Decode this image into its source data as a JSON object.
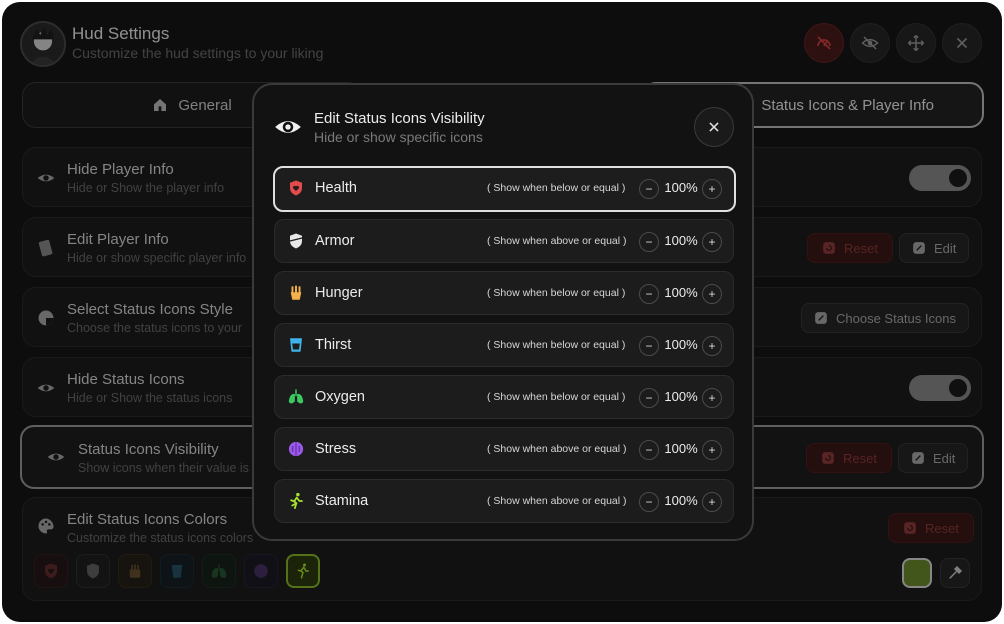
{
  "header": {
    "title": "Hud Settings",
    "subtitle": "Customize the hud settings to your liking",
    "buttons": [
      "speedometer-off-icon",
      "eye-off-icon",
      "move-icon",
      "close-icon"
    ]
  },
  "tabs": [
    {
      "label": "General",
      "icon": "home-icon"
    },
    {
      "label": "Status Icons & Player Info",
      "icon": ""
    }
  ],
  "rows": [
    {
      "title": "Hide Player Info",
      "subtitle": "Hide or Show the player info",
      "control": "toggle"
    },
    {
      "title": "Edit Player Info",
      "subtitle": "Hide or show specific player info",
      "reset": "Reset",
      "edit": "Edit"
    },
    {
      "title": "Select Status Icons Style",
      "subtitle": "Choose the status icons to your",
      "button": "Choose Status Icons"
    },
    {
      "title": "Hide Status Icons",
      "subtitle": "Hide or Show the status icons",
      "control": "toggle"
    },
    {
      "title": "Status Icons Visibility",
      "subtitle": "Show icons when their value is",
      "reset": "Reset",
      "edit": "Edit"
    },
    {
      "title": "Edit Status Icons Colors",
      "subtitle": "Customize the status icons colors",
      "reset": "Reset"
    }
  ],
  "colors": {
    "accent_selected": "#6b8a2a",
    "health": "#e24c4c",
    "armor": "#e8e8e8",
    "hunger": "#f3b04b",
    "thirst": "#3fb4ea",
    "oxygen": "#3cc860",
    "stress": "#9b59e8",
    "stamina": "#a6e22e"
  },
  "modal": {
    "title": "Edit Status Icons Visibility",
    "subtitle": "Hide or show specific icons",
    "items": [
      {
        "name": "Health",
        "condition": "( Show when below or equal )",
        "value": "100%",
        "icon": "shield-heart-icon"
      },
      {
        "name": "Armor",
        "condition": "( Show when above or equal )",
        "value": "100%",
        "icon": "armor-icon"
      },
      {
        "name": "Hunger",
        "condition": "( Show when below or equal )",
        "value": "100%",
        "icon": "fries-icon"
      },
      {
        "name": "Thirst",
        "condition": "( Show when below or equal )",
        "value": "100%",
        "icon": "cup-icon"
      },
      {
        "name": "Oxygen",
        "condition": "( Show when below or equal )",
        "value": "100%",
        "icon": "lungs-icon"
      },
      {
        "name": "Stress",
        "condition": "( Show when above or equal )",
        "value": "100%",
        "icon": "brain-icon"
      },
      {
        "name": "Stamina",
        "condition": "( Show when above or equal )",
        "value": "100%",
        "icon": "runner-icon"
      }
    ]
  }
}
